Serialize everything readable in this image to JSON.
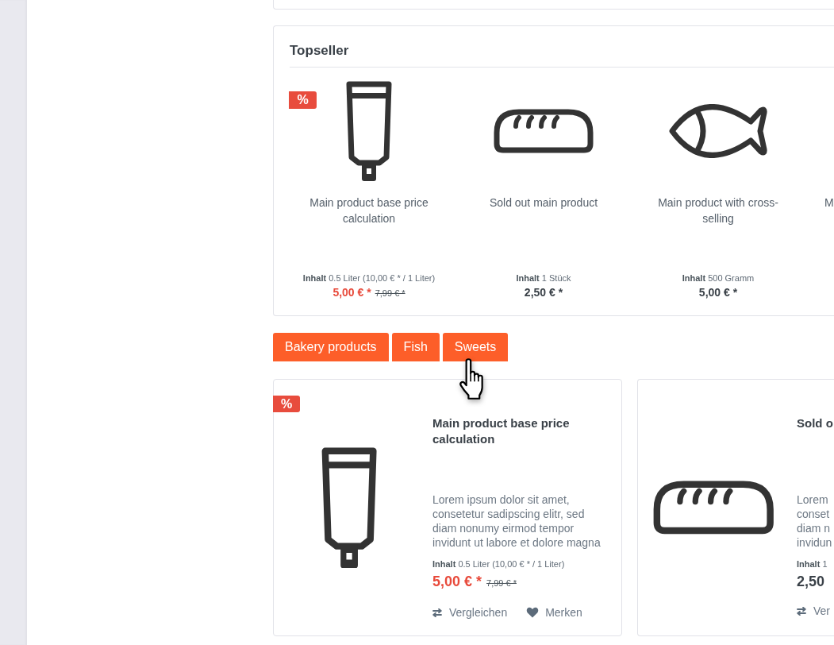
{
  "topseller": {
    "title": "Topseller",
    "items": [
      {
        "kind": "tube",
        "badge": "%",
        "name": "Main product base price calculation",
        "content_label": "Inhalt",
        "content": "0.5 Liter (10,00 € * / 1 Liter)",
        "price": "5,00 € *",
        "old_price": "7,99 € *",
        "discounted": true
      },
      {
        "kind": "bread",
        "name": "Sold out main product",
        "content_label": "Inhalt",
        "content": "1 Stück",
        "price": "2,50 € *",
        "discounted": false
      },
      {
        "kind": "fish",
        "name": "Main product with cross-selling",
        "content_label": "Inhalt",
        "content": "500 Gramm",
        "price": "5,00 € *",
        "discounted": false
      },
      {
        "kind": "cut",
        "name": "M"
      }
    ]
  },
  "category_tabs": [
    {
      "label": "Bakery products",
      "hovered": false
    },
    {
      "label": "Fish",
      "hovered": false
    },
    {
      "label": "Sweets",
      "hovered": true
    }
  ],
  "products": [
    {
      "kind": "tube",
      "badge": "%",
      "name": "Main product base price calculation",
      "description": "Lorem ipsum dolor sit amet, consetetur sadipscing elitr, sed diam nonumy eirmod tempor invidunt ut labore et dolore magna",
      "content_label": "Inhalt",
      "content": "0.5 Liter (10,00 € * / 1 Liter)",
      "price": "5,00 € *",
      "old_price": "7,99 € *",
      "discounted": true,
      "actions": [
        {
          "kind": "compare",
          "label": "Vergleichen"
        },
        {
          "kind": "wishlist",
          "label": "Merken"
        }
      ]
    },
    {
      "kind": "bread",
      "name": "Sold o",
      "description_lines": [
        "Lorem",
        "conset",
        "diam n",
        "invidun"
      ],
      "content_label": "Inhalt",
      "content": "1",
      "price": "2,50",
      "discounted": false,
      "actions": [
        {
          "kind": "compare",
          "label": "Ver"
        }
      ]
    }
  ]
}
